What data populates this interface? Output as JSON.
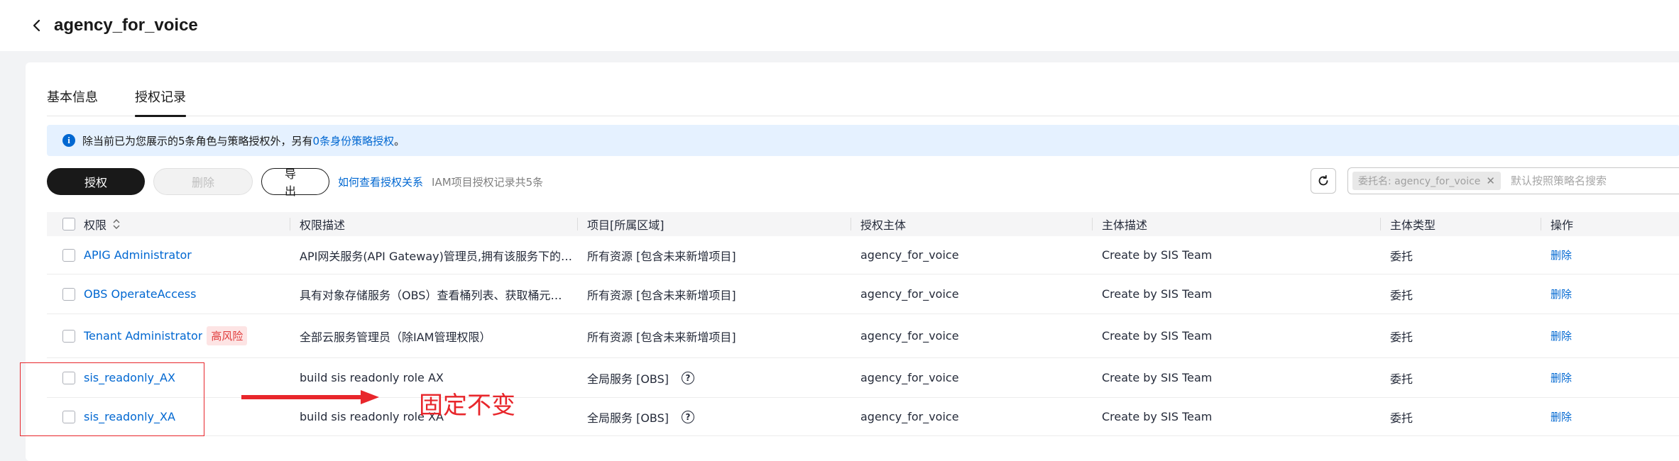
{
  "header": {
    "title": "agency_for_voice",
    "back_icon": "chevron-left-icon"
  },
  "tabs": [
    {
      "label": "基本信息",
      "active": false
    },
    {
      "label": "授权记录",
      "active": true
    }
  ],
  "alert": {
    "text_before": "除当前已为您展示的5条角色与策略授权外，另有",
    "link": "0条身份策略授权",
    "text_after": "。",
    "icon": "info-icon"
  },
  "toolbar": {
    "authorize_label": "授权",
    "delete_label": "删除",
    "export_label": "导出",
    "help_link": "如何查看授权关系",
    "record_count": "IAM项目授权记录共5条",
    "refresh_icon": "refresh-icon",
    "filter_tag": "委托名: agency_for_voice",
    "search_placeholder": "默认按照策略名搜索"
  },
  "table": {
    "columns": [
      "权限",
      "权限描述",
      "项目[所属区域]",
      "授权主体",
      "主体描述",
      "主体类型",
      "操作"
    ],
    "rows": [
      {
        "permission": "APIG Administrator",
        "description": "API网关服务(API Gateway)管理员,拥有该服务下的…",
        "project": "所有资源 [包含未来新增项目]",
        "subject": "agency_for_voice",
        "subject_desc": "Create by SIS Team",
        "subject_type": "委托",
        "operation": "删除",
        "risk": "",
        "help": false
      },
      {
        "permission": "OBS OperateAccess",
        "description": "具有对象存储服务（OBS）查看桶列表、获取桶元…",
        "project": "所有资源 [包含未来新增项目]",
        "subject": "agency_for_voice",
        "subject_desc": "Create by SIS Team",
        "subject_type": "委托",
        "operation": "删除",
        "risk": "",
        "help": false
      },
      {
        "permission": "Tenant Administrator",
        "description": "全部云服务管理员（除IAM管理权限）",
        "project": "所有资源 [包含未来新增项目]",
        "subject": "agency_for_voice",
        "subject_desc": "Create by SIS Team",
        "subject_type": "委托",
        "operation": "删除",
        "risk": "高风险",
        "help": false
      },
      {
        "permission": "sis_readonly_AX",
        "description": "build sis readonly role AX",
        "project": "全局服务 [OBS]",
        "subject": "agency_for_voice",
        "subject_desc": "Create by SIS Team",
        "subject_type": "委托",
        "operation": "删除",
        "risk": "",
        "help": true
      },
      {
        "permission": "sis_readonly_XA",
        "description": "build sis readonly role XA",
        "project": "全局服务 [OBS]",
        "subject": "agency_for_voice",
        "subject_desc": "Create by SIS Team",
        "subject_type": "委托",
        "operation": "删除",
        "risk": "",
        "help": true
      }
    ]
  },
  "annotation": {
    "text": "固定不变",
    "color": "#e8262b"
  },
  "colors": {
    "link": "#0067d1",
    "primary_button": "#191919",
    "alert_bg": "#e5f1ff",
    "risk_text": "#e03b3b"
  }
}
